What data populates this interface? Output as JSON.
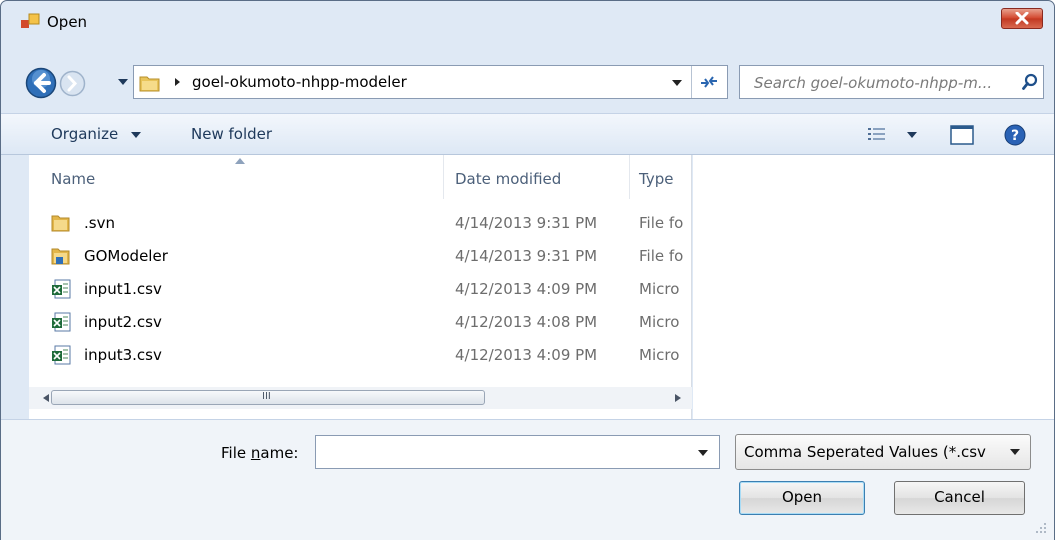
{
  "window": {
    "title": "Open"
  },
  "nav": {
    "path_segment": "goel-okumoto-nhpp-modeler",
    "search_placeholder": "Search goel-okumoto-nhpp-m..."
  },
  "toolbar": {
    "organize_label": "Organize",
    "new_folder_label": "New folder"
  },
  "file_list": {
    "columns": [
      "Name",
      "Date modified",
      "Type"
    ],
    "rows": [
      {
        "name": ".svn",
        "date": "4/14/2013 9:31 PM",
        "type": "File fo",
        "icon": "folder-icon"
      },
      {
        "name": "GOModeler",
        "date": "4/14/2013 9:31 PM",
        "type": "File fo",
        "icon": "folder-icon"
      },
      {
        "name": "input1.csv",
        "date": "4/12/2013 4:09 PM",
        "type": "Micro",
        "icon": "excel-file-icon"
      },
      {
        "name": "input2.csv",
        "date": "4/12/2013 4:08 PM",
        "type": "Micro",
        "icon": "excel-file-icon"
      },
      {
        "name": "input3.csv",
        "date": "4/12/2013 4:09 PM",
        "type": "Micro",
        "icon": "excel-file-icon"
      }
    ],
    "scroll_grip": "III"
  },
  "bottom": {
    "file_name_label_pre": "File ",
    "file_name_label_mnemonic": "n",
    "file_name_label_post": "ame:",
    "file_name_value": "",
    "file_type_selected": "Comma Seperated Values (*.csv",
    "open_label": "Open",
    "cancel_label": "Cancel"
  },
  "colors": {
    "window_bg": "#dfe9f5",
    "close_button": "#c13721",
    "header_text": "#4c607a",
    "folder": "#e8c45a"
  }
}
